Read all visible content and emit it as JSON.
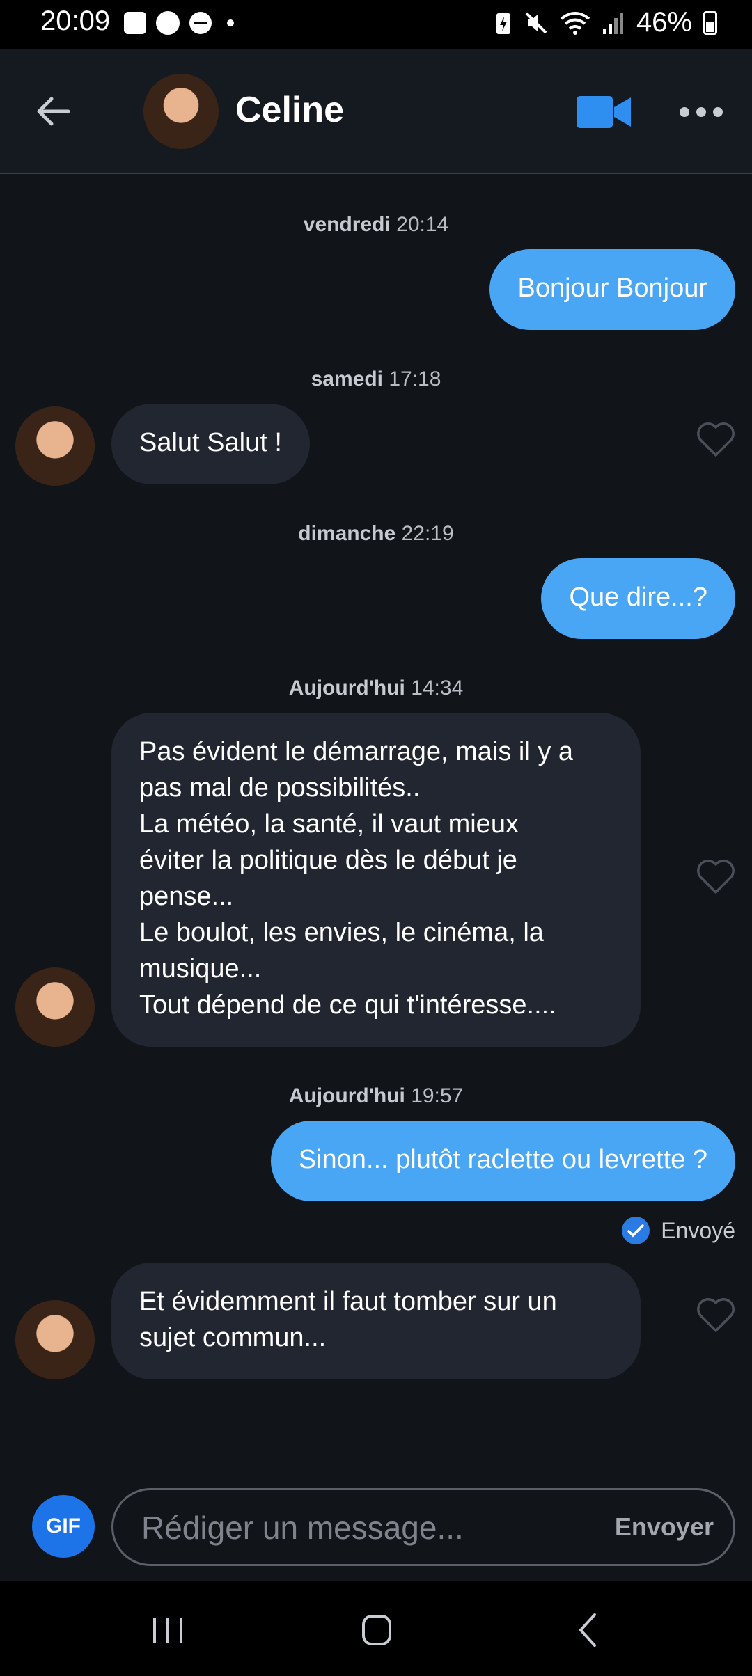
{
  "status_bar": {
    "time": "20:09",
    "battery": "46%",
    "icons": [
      "gallery-icon",
      "game-icon",
      "dnd-icon",
      "notification-dot",
      "battery-saver-icon",
      "mute-icon",
      "wifi-icon",
      "signal-icon",
      "battery-icon"
    ]
  },
  "header": {
    "contact_name": "Celine",
    "back_icon": "arrow-left-icon",
    "video_icon": "video-camera-icon",
    "more_icon": "more-dots-icon",
    "accent": "#2f8ff0"
  },
  "messages": [
    {
      "timestamp_day": "vendredi",
      "timestamp_time": "20:14"
    },
    {
      "direction": "out",
      "text": "Bonjour Bonjour"
    },
    {
      "timestamp_day": "samedi",
      "timestamp_time": "17:18"
    },
    {
      "direction": "in",
      "text": "Salut Salut !"
    },
    {
      "timestamp_day": "dimanche",
      "timestamp_time": "22:19"
    },
    {
      "direction": "out",
      "text": "Que dire...?"
    },
    {
      "timestamp_day": "Aujourd'hui",
      "timestamp_time": "14:34"
    },
    {
      "direction": "in",
      "lines": [
        "Pas évident le démarrage, mais il y a",
        "pas mal de possibilités..",
        "La météo, la santé, il vaut mieux",
        "éviter la politique dès le début je",
        "pense...",
        "Le boulot, les envies, le cinéma, la",
        "musique...",
        "Tout dépend de ce qui t'intéresse...."
      ]
    },
    {
      "timestamp_day": "Aujourd'hui",
      "timestamp_time": "19:57"
    },
    {
      "direction": "out",
      "text": "Sinon... plutôt raclette ou levrette ?"
    },
    {
      "status": "Envoyé"
    },
    {
      "direction": "in",
      "lines": [
        "Et évidemment il faut tomber sur un",
        "sujet commun..."
      ]
    }
  ],
  "composer": {
    "gif_label": "GIF",
    "placeholder": "Rédiger un message...",
    "send_label": "Envoyer"
  },
  "nav": {
    "items": [
      "recents-icon",
      "home-icon",
      "back-icon"
    ]
  },
  "colors": {
    "background": "#111419",
    "outgoing_bubble": "#49a6f4",
    "incoming_bubble": "#222630",
    "gif_button": "#1c74e8"
  }
}
